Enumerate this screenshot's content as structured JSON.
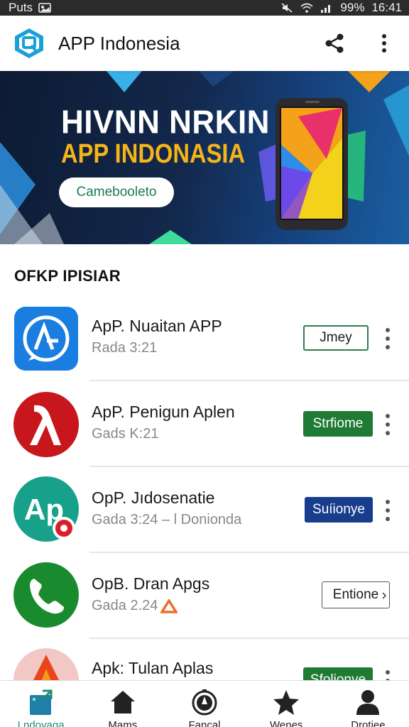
{
  "status_bar": {
    "carrier": "Puts",
    "battery": "99%",
    "time": "16:41"
  },
  "app_bar": {
    "title": "APP Indonesia",
    "logo_icon": "app-logo-icon",
    "share_icon": "share-icon",
    "more_icon": "more-vert-icon"
  },
  "banner": {
    "line1": "HIVNN NRKIN",
    "line2": "APP INDONASIA",
    "button_label": "Camebooleto",
    "accent_color": "#f4b41a"
  },
  "section": {
    "title": "OFKP IPISIAR"
  },
  "apps": [
    {
      "name": "ApP. Nuaitan APP",
      "meta": "Rada 3:21",
      "button": "Jmey",
      "button_style": "outline-green",
      "icon": "app-store-icon"
    },
    {
      "name": "ApP. Penigun Aplen",
      "meta": "Gads K:21",
      "button": "Strfiome",
      "button_style": "green",
      "icon": "lambda-icon"
    },
    {
      "name": "OpP. Jıdosenatie",
      "meta": "Gada 3:24 – l Donionda",
      "button": "Suíionye",
      "button_style": "navy",
      "icon": "ap-icon"
    },
    {
      "name": "OpB. Dran Apgs",
      "meta": "Gada 2.24",
      "button": "Entione",
      "button_style": "outline-dark",
      "icon": "phone-icon"
    },
    {
      "name": "Apk: Tulan Aplas",
      "meta": "",
      "button": "Sfolionye",
      "button_style": "green",
      "icon": "arrow-up-icon"
    }
  ],
  "bottom_nav": [
    {
      "label": "Lndoyaga",
      "icon": "home-box-icon",
      "active": true
    },
    {
      "label": "Mams",
      "icon": "house-icon",
      "active": false
    },
    {
      "label": "Fancal",
      "icon": "compass-icon",
      "active": false
    },
    {
      "label": "Wenes",
      "icon": "star-icon",
      "active": false
    },
    {
      "label": "Drotiee",
      "icon": "person-icon",
      "active": false
    }
  ],
  "colors": {
    "brand": "#1c8f73",
    "primary_blue": "#173d8c",
    "green": "#1f7a34"
  }
}
